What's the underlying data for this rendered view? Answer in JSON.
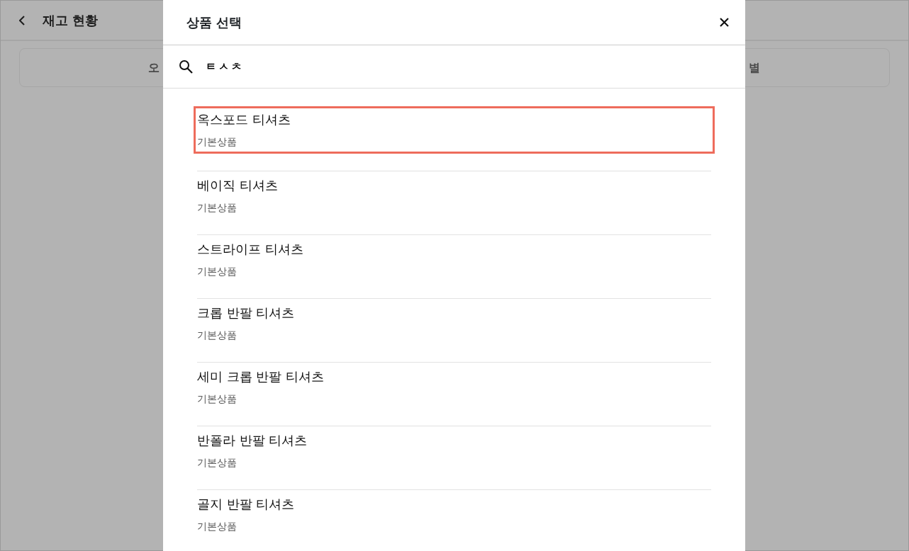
{
  "background": {
    "title": "재고 현황",
    "segments": [
      {
        "label": "오"
      },
      {
        "label": "별"
      }
    ]
  },
  "modal": {
    "title": "상품 선택",
    "search": {
      "value": "ㅌㅅㅊ"
    },
    "items": [
      {
        "name": "옥스포드 티셔츠",
        "type": "기본상품",
        "highlighted": true
      },
      {
        "name": "베이직 티셔츠",
        "type": "기본상품",
        "highlighted": false
      },
      {
        "name": "스트라이프 티셔츠",
        "type": "기본상품",
        "highlighted": false
      },
      {
        "name": "크롭 반팔 티셔츠",
        "type": "기본상품",
        "highlighted": false
      },
      {
        "name": "세미 크롭 반팔 티셔츠",
        "type": "기본상품",
        "highlighted": false
      },
      {
        "name": "반폴라 반팔 티셔츠",
        "type": "기본상품",
        "highlighted": false
      },
      {
        "name": "골지 반팔 티셔츠",
        "type": "기본상품",
        "highlighted": false
      }
    ]
  }
}
